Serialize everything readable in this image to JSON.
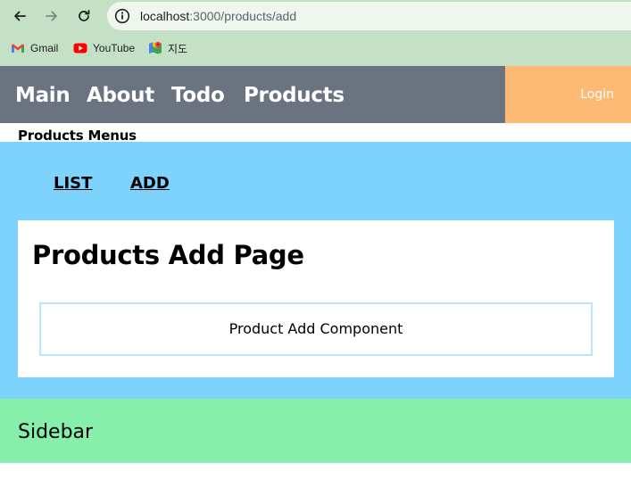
{
  "browser": {
    "url_host": "localhost",
    "url_path": ":3000/products/add",
    "bookmarks": [
      {
        "label": "Gmail",
        "icon": "gmail-icon"
      },
      {
        "label": "YouTube",
        "icon": "youtube-icon"
      },
      {
        "label": "지도",
        "icon": "maps-icon"
      }
    ]
  },
  "nav": {
    "links": [
      "Main",
      "About",
      "Todo",
      "Products"
    ],
    "login": "Login"
  },
  "products": {
    "menus_title": "Products Menus",
    "menu": [
      "LIST",
      "ADD"
    ],
    "page_title": "Products Add Page",
    "component": "Product Add Component"
  },
  "sidebar": {
    "label": "Sidebar"
  },
  "colors": {
    "chrome": "#c4e1c6",
    "nav_bg": "#6b7280",
    "login_bg": "#fdba74",
    "content_bg": "#7dd3fc",
    "component_border": "#bae6fd",
    "sidebar_bg": "#86efac"
  }
}
